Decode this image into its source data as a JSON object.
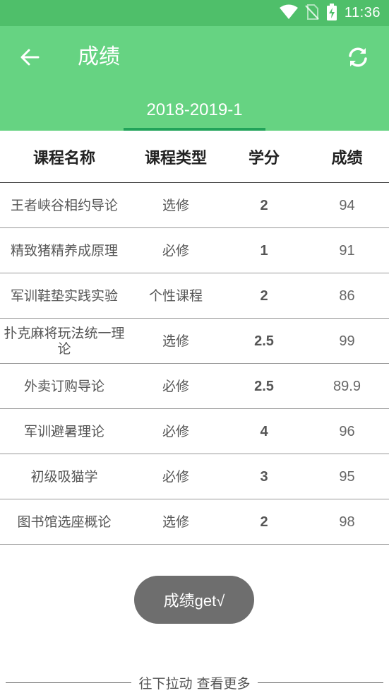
{
  "status_bar": {
    "time": "11:36",
    "icons": [
      "wifi-icon",
      "no-sim-icon",
      "battery-charging-icon"
    ]
  },
  "header": {
    "title": "成绩",
    "back_icon": "arrow-left-icon",
    "refresh_icon": "refresh-icon",
    "term": "2018-2019-1"
  },
  "table": {
    "headers": [
      "课程名称",
      "课程类型",
      "学分",
      "成绩"
    ],
    "rows": [
      [
        "王者峡谷相约导论",
        "选修",
        "2",
        "94"
      ],
      [
        "精致猪精养成原理",
        "必修",
        "1",
        "91"
      ],
      [
        "军训鞋垫实践实验",
        "个性课程",
        "2",
        "86"
      ],
      [
        "扑克麻将玩法统一理论",
        "选修",
        "2.5",
        "99"
      ],
      [
        "外卖订购导论",
        "必修",
        "2.5",
        "89.9"
      ],
      [
        "军训避暑理论",
        "必修",
        "4",
        "96"
      ],
      [
        "初级吸猫学",
        "必修",
        "3",
        "95"
      ],
      [
        "图书馆选座概论",
        "选修",
        "2",
        "98"
      ]
    ]
  },
  "button": {
    "label": "成绩get√"
  },
  "footer": {
    "pull_hint": "往下拉动 查看更多"
  },
  "colors": {
    "status_bar": "#4fbf6a",
    "app_bar": "#66d382",
    "tab_indicator": "#22a35a",
    "button": "#6e6e6e"
  }
}
